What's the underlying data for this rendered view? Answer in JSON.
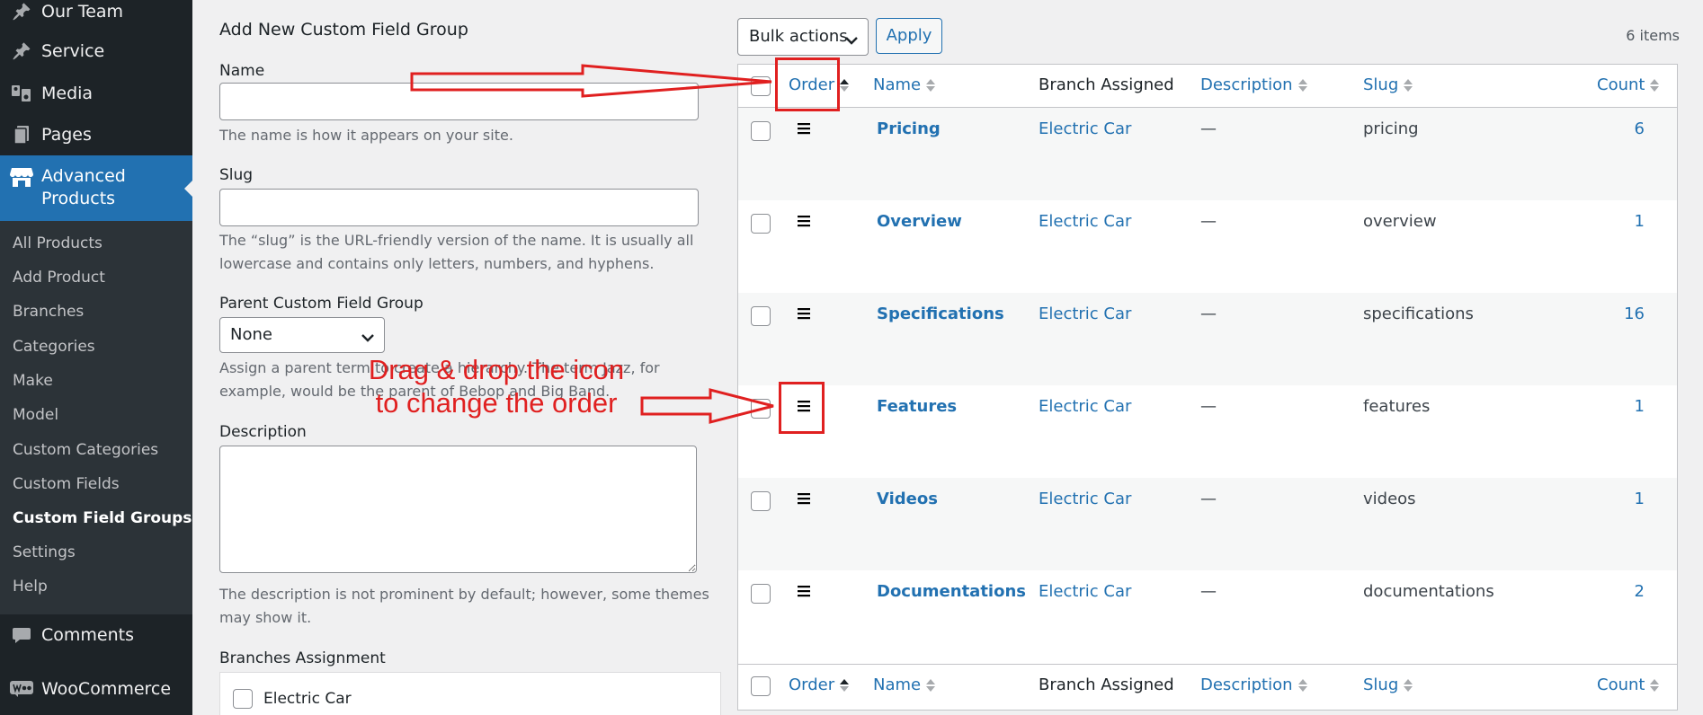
{
  "sidebar": {
    "top_items": [
      {
        "label": "Our Team",
        "icon": "pin-icon"
      },
      {
        "label": "Service",
        "icon": "pin-icon"
      },
      {
        "label": "Media",
        "icon": "media-icon"
      },
      {
        "label": "Pages",
        "icon": "pages-icon"
      }
    ],
    "current": {
      "label": "Advanced Products",
      "icon": "store-icon"
    },
    "submenu": [
      "All Products",
      "Add Product",
      "Branches",
      "Categories",
      "Make",
      "Model",
      "Custom Categories",
      "Custom Fields",
      "Custom Field Groups",
      "Settings",
      "Help"
    ],
    "submenu_current": "Custom Field Groups",
    "bottom_items": [
      {
        "label": "Comments",
        "icon": "comment-icon"
      },
      {
        "label": "WooCommerce",
        "icon": "woo-icon"
      }
    ]
  },
  "form": {
    "title": "Add New Custom Field Group",
    "name_label": "Name",
    "name_value": "",
    "name_help": "The name is how it appears on your site.",
    "slug_label": "Slug",
    "slug_value": "",
    "slug_help_1": "The “slug” is the URL-friendly version of the name. It is usually all",
    "slug_help_2": "lowercase and contains only letters, numbers, and hyphens.",
    "parent_label": "Parent Custom Field Group",
    "parent_value": "None",
    "parent_help_1": "Assign a parent term to create a hierarchy. The term Jazz, for",
    "parent_help_2": "example, would be the parent of Bebop and Big Band.",
    "description_label": "Description",
    "description_value": "",
    "description_help_1": "The description is not prominent by default; however, some themes",
    "description_help_2": "may show it.",
    "branches_label": "Branches Assignment",
    "branches": [
      {
        "label": "Electric Car",
        "checked": false
      }
    ]
  },
  "table": {
    "bulk_actions": "Bulk actions",
    "apply": "Apply",
    "items_count": "6 items",
    "columns": {
      "order": "Order",
      "name": "Name",
      "branch": "Branch Assigned",
      "description": "Description",
      "slug": "Slug",
      "count": "Count"
    },
    "rows": [
      {
        "name": "Pricing",
        "branch": "Electric Car",
        "description": "—",
        "slug": "pricing",
        "count": "6"
      },
      {
        "name": "Overview",
        "branch": "Electric Car",
        "description": "—",
        "slug": "overview",
        "count": "1"
      },
      {
        "name": "Specifications",
        "branch": "Electric Car",
        "description": "—",
        "slug": "specifications",
        "count": "16"
      },
      {
        "name": "Features",
        "branch": "Electric Car",
        "description": "—",
        "slug": "features",
        "count": "1"
      },
      {
        "name": "Videos",
        "branch": "Electric Car",
        "description": "—",
        "slug": "videos",
        "count": "1"
      },
      {
        "name": "Documentations",
        "branch": "Electric Car",
        "description": "—",
        "slug": "documentations",
        "count": "2"
      }
    ]
  },
  "annotation": {
    "line1": "Drag & drop the icon",
    "line2": "to change the order",
    "color": "#e02020"
  },
  "colors": {
    "accent": "#2271b1",
    "sidebar": "#1d2327",
    "submenu": "#2c3338"
  }
}
